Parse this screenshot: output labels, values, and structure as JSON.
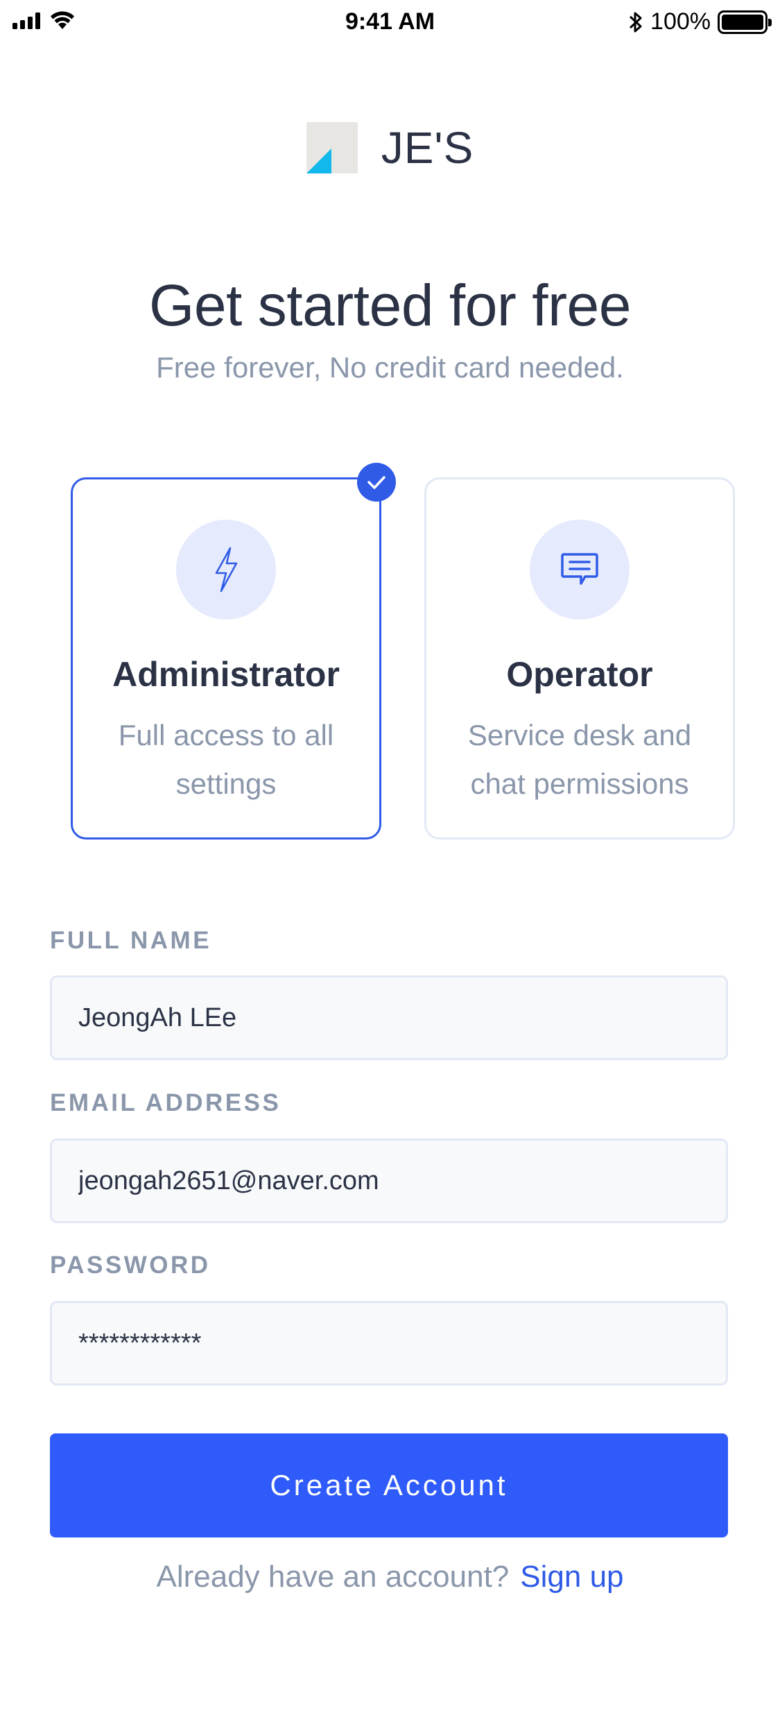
{
  "status_bar": {
    "time": "9:41 AM",
    "battery_text": "100%"
  },
  "brand": {
    "name": "JE'S",
    "colors": {
      "accent": "#2f5bfa",
      "logo_cyan": "#12b8eb",
      "logo_grey": "#e7e6e3"
    }
  },
  "header": {
    "title": "Get started for free",
    "subtitle": "Free forever, No credit card needed."
  },
  "roles": [
    {
      "title": "Administrator",
      "description": "Full access to all settings",
      "icon": "lightning-icon",
      "selected": true
    },
    {
      "title": "Operator",
      "description": "Service desk and chat permissions",
      "icon": "chat-icon",
      "selected": false
    }
  ],
  "form": {
    "full_name": {
      "label": "FULL NAME",
      "value": "JeongAh LEe"
    },
    "email": {
      "label": "EMAIL ADDRESS",
      "value": "jeongah2651@naver.com"
    },
    "password": {
      "label": "PASSWORD",
      "value": "************"
    }
  },
  "actions": {
    "create_label": "Create Account",
    "footer_text": "Already have an account?",
    "signup_label": "Sign up"
  }
}
